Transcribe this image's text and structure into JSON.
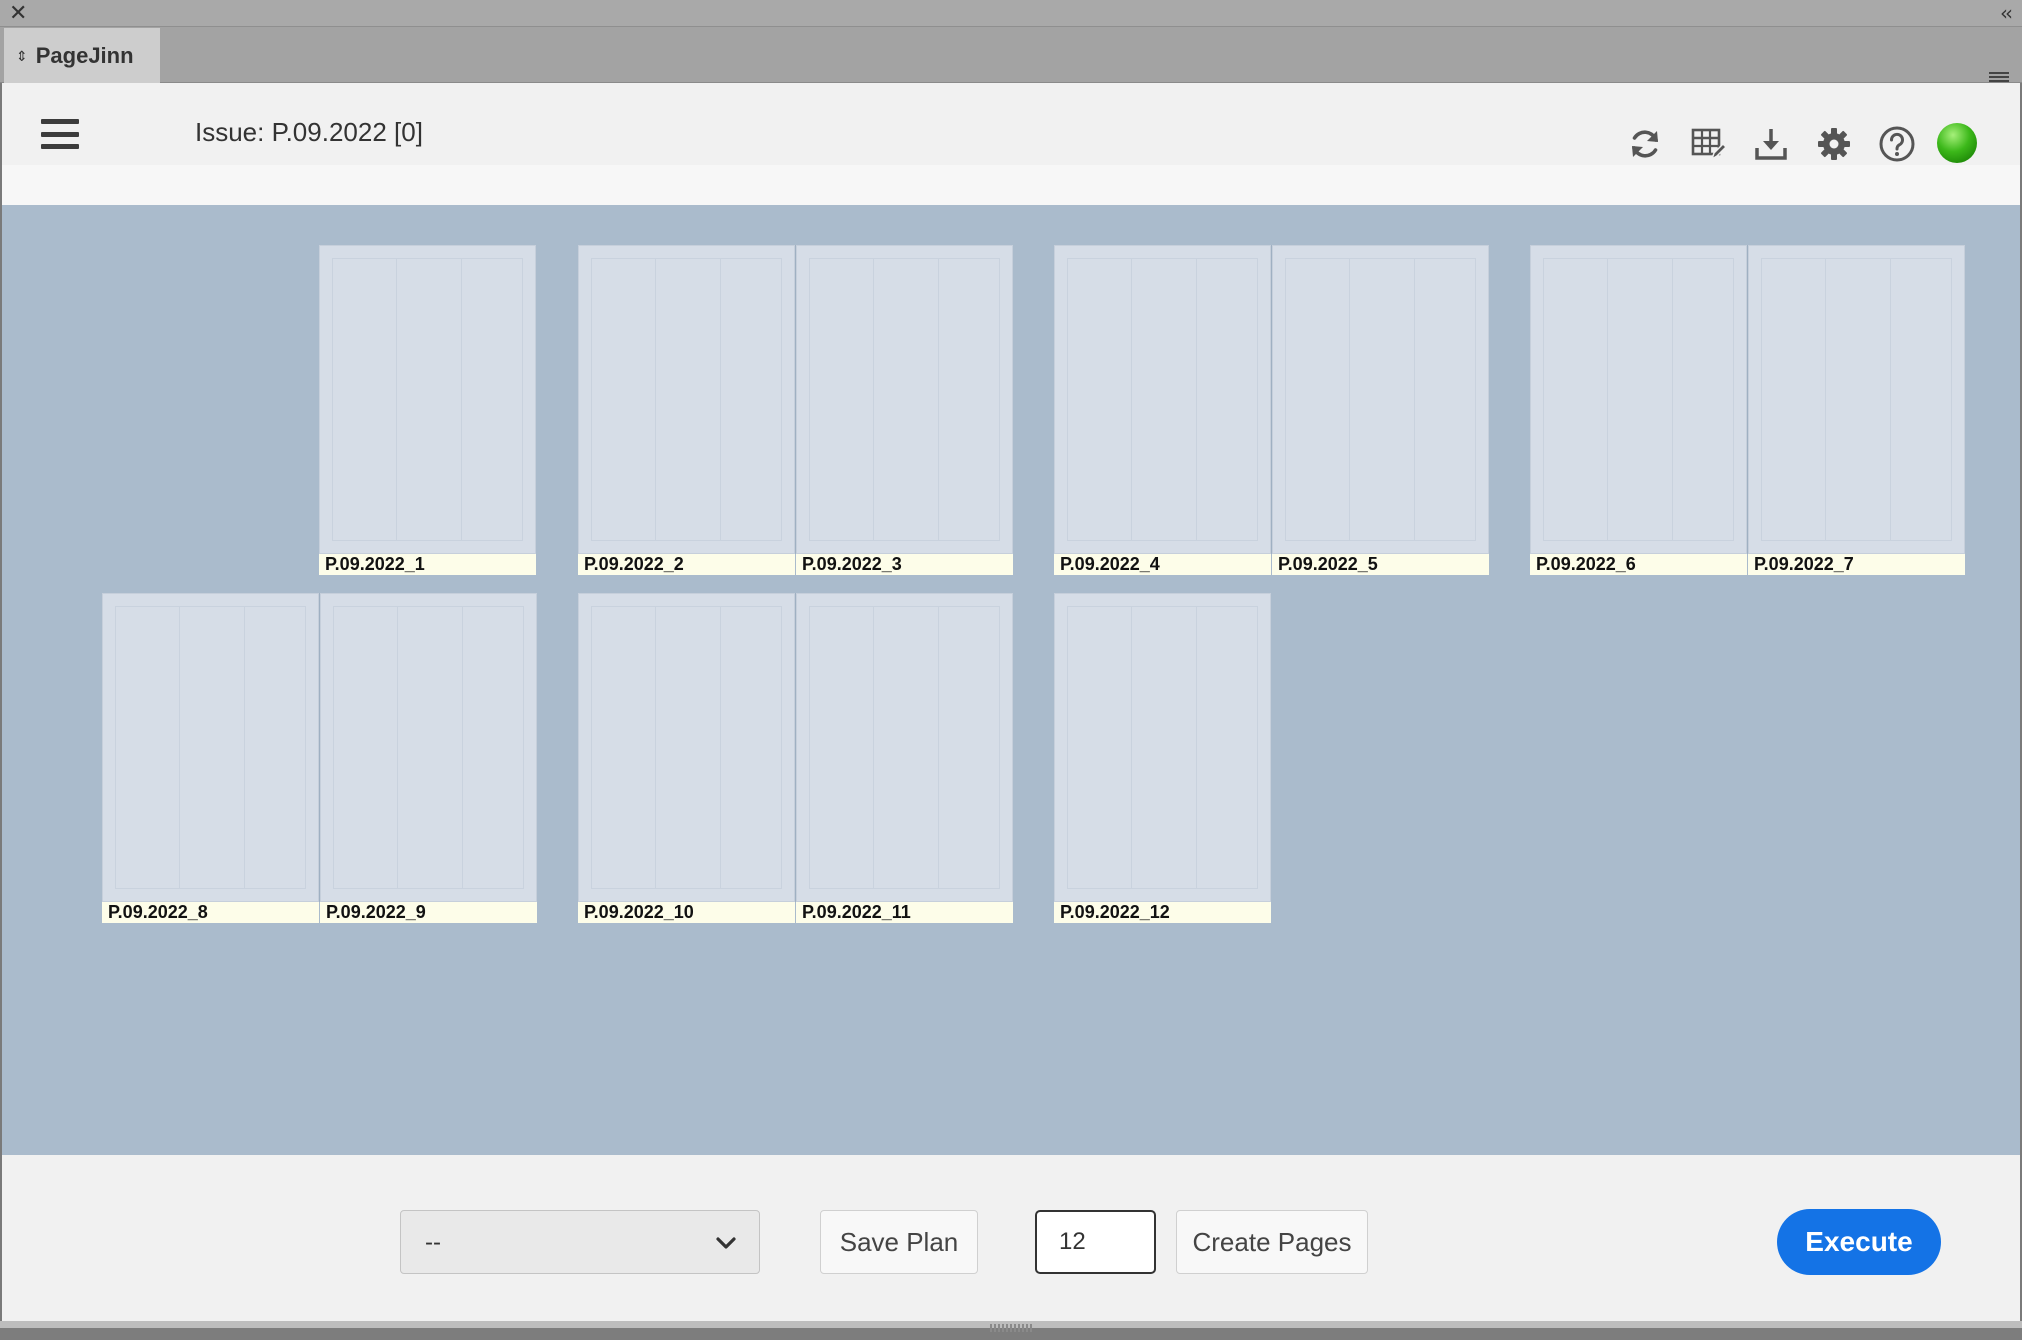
{
  "panel": {
    "close_glyph": "✕",
    "collapse_glyph": "‹‹",
    "tab_label": "PageJinn",
    "tab_arrows": "⇕"
  },
  "header": {
    "issue_title": "Issue: P.09.2022 [0]",
    "icons": [
      "refresh-icon",
      "edit-grid-icon",
      "download-icon",
      "settings-gear-icon",
      "help-icon",
      "status-indicator"
    ],
    "status_color": "#3cb81a"
  },
  "pages": [
    {
      "label": "P.09.2022_1"
    },
    {
      "label": "P.09.2022_2"
    },
    {
      "label": "P.09.2022_3"
    },
    {
      "label": "P.09.2022_4"
    },
    {
      "label": "P.09.2022_5"
    },
    {
      "label": "P.09.2022_6"
    },
    {
      "label": "P.09.2022_7"
    },
    {
      "label": "P.09.2022_8"
    },
    {
      "label": "P.09.2022_9"
    },
    {
      "label": "P.09.2022_10"
    },
    {
      "label": "P.09.2022_11"
    },
    {
      "label": "P.09.2022_12"
    }
  ],
  "footer": {
    "plan_select_value": "--",
    "save_plan_label": "Save Plan",
    "page_count_value": "12",
    "create_pages_label": "Create Pages",
    "execute_label": "Execute",
    "execute_color": "#1473e6"
  },
  "colors": {
    "canvas_bg": "#aabbcc",
    "label_bg": "#fdfde9",
    "page_bg": "#d6dde7"
  }
}
